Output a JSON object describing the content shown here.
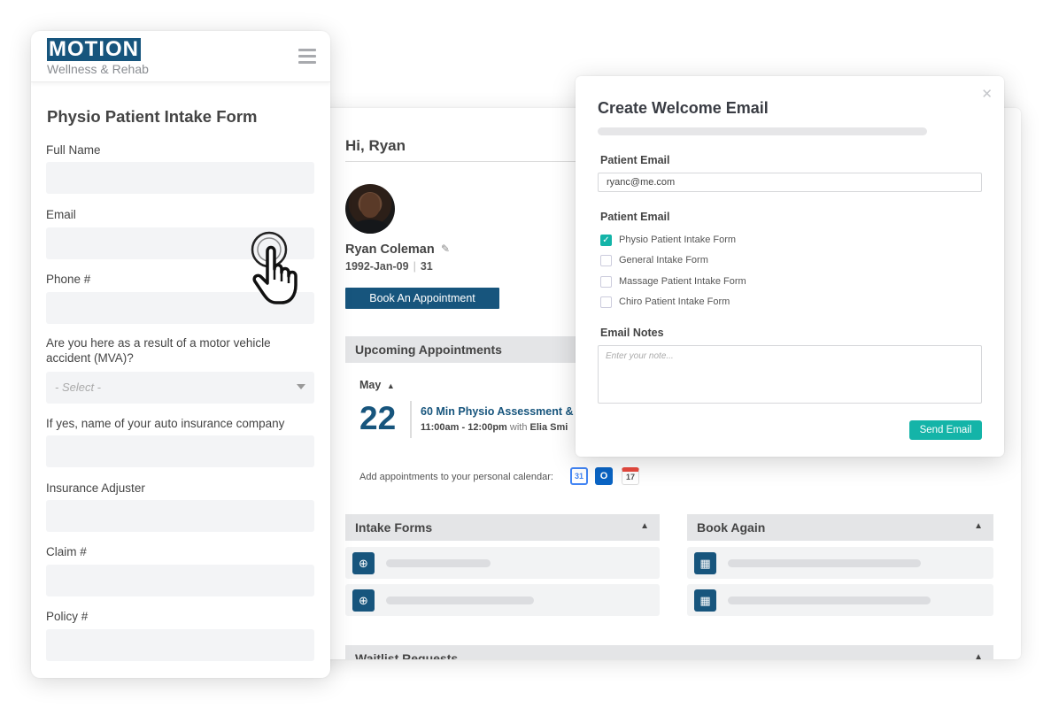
{
  "dashboard": {
    "greeting": "Hi, Ryan",
    "patient_name": "Ryan Coleman",
    "patient_dob": "1992-Jan-09",
    "patient_age": "31",
    "book_button": "Book An Appointment",
    "upcoming_title": "Upcoming Appointments",
    "month": "May",
    "day": "22",
    "appointment_title": "60 Min Physio Assessment &",
    "appointment_time": "11:00am - 12:00pm",
    "appointment_with": "with",
    "appointment_practitioner": "Elia Smi",
    "calendar_text": "Add appointments to your personal calendar:",
    "calendar_icons": [
      "google-calendar-icon",
      "outlook-icon",
      "apple-calendar-icon"
    ],
    "google_cal_num": "31",
    "outlook_letter": "O",
    "apple_cal_num": "17",
    "intake_title": "Intake Forms",
    "book_again_title": "Book Again",
    "waitlist_title": "Waitlist Requests"
  },
  "modal": {
    "title": "Create Welcome Email",
    "patient_email_label": "Patient Email",
    "patient_email_value": "ryanc@me.com",
    "forms_label": "Patient Email",
    "forms": [
      {
        "label": "Physio Patient Intake Form",
        "checked": true
      },
      {
        "label": "General Intake Form",
        "checked": false
      },
      {
        "label": "Massage Patient Intake Form",
        "checked": false
      },
      {
        "label": "Chiro Patient Intake Form",
        "checked": false
      }
    ],
    "notes_label": "Email Notes",
    "notes_placeholder": "Enter your note...",
    "send_button": "Send Email",
    "accent": "#14b4a8"
  },
  "phone": {
    "logo_main": "MOTION",
    "logo_sub": "Wellness & Rehab",
    "form_title": "Physio Patient Intake Form",
    "fields": {
      "full_name": "Full Name",
      "email": "Email",
      "phone": "Phone #",
      "mva": "Are you here as a result of a motor vehicle accident (MVA)?",
      "mva_placeholder": "- Select -",
      "insurance_company": "If yes, name of your auto insurance company",
      "adjuster": "Insurance Adjuster",
      "claim": "Claim #",
      "policy": "Policy #"
    },
    "brand_color": "#17557d"
  },
  "colors": {
    "brand": "#17557d",
    "accent": "#14b4a8"
  }
}
